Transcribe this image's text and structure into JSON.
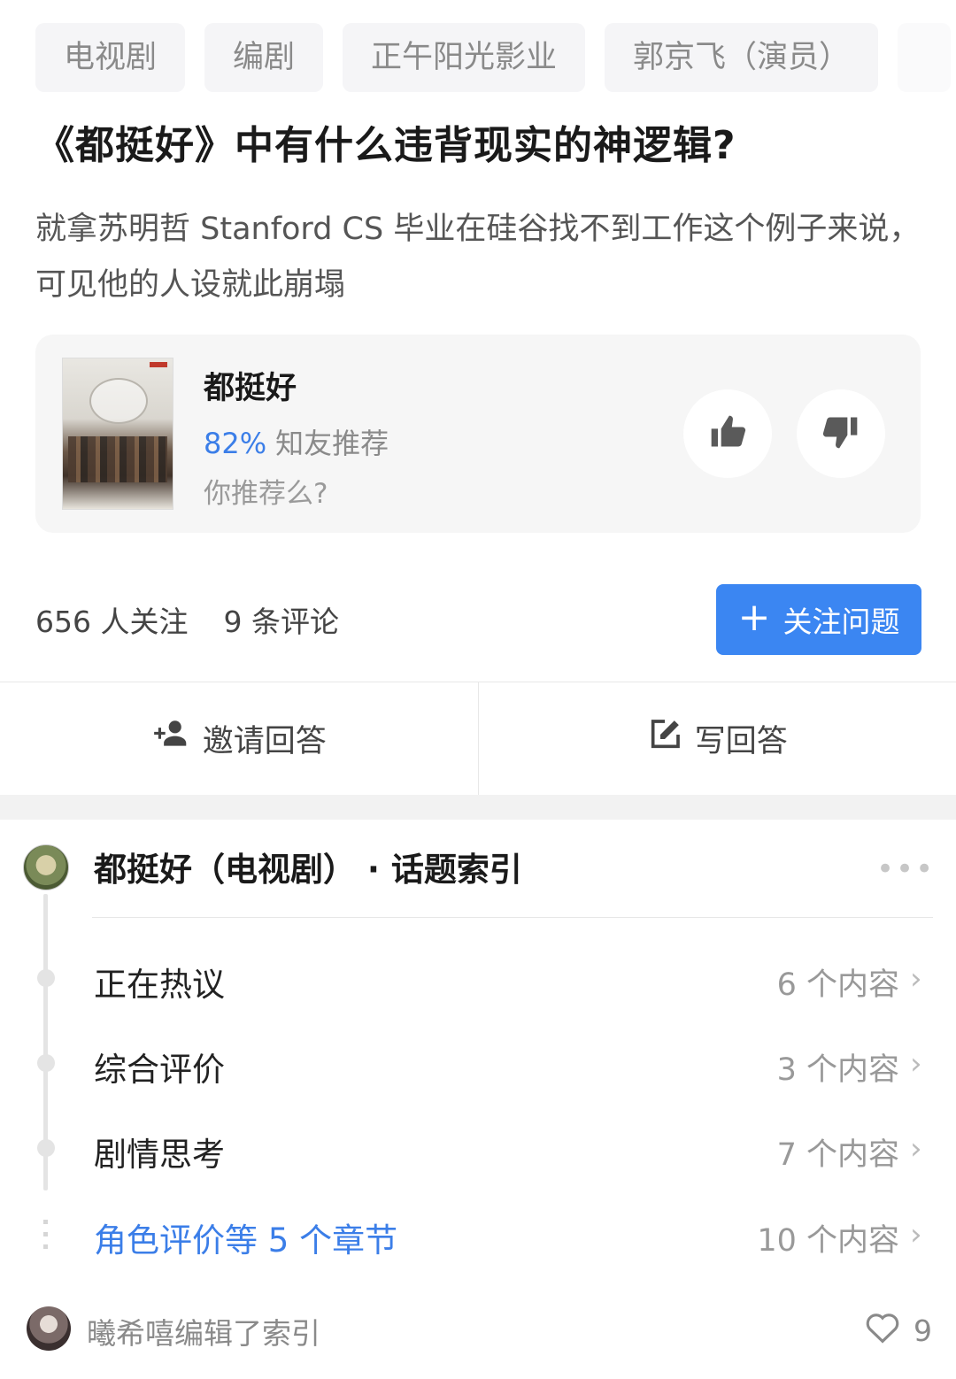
{
  "tags": [
    "电视剧",
    "编剧",
    "正午阳光影业",
    "郭京飞（演员）"
  ],
  "question": {
    "title": "《都挺好》中有什么违背现实的神逻辑?",
    "description": "就拿苏明哲 Stanford CS 毕业在硅谷找不到工作这个例子来说，可见他的人设就此崩塌"
  },
  "recommend_card": {
    "name": "都挺好",
    "percent": "82%",
    "percent_label": "知友推荐",
    "prompt": "你推荐么?",
    "upvote_icon": "thumbs-up-icon",
    "downvote_icon": "thumbs-down-icon"
  },
  "stats": {
    "followers": "656 人关注",
    "comments": "9 条评论"
  },
  "follow_button": {
    "label": "关注问题",
    "icon": "plus-icon",
    "color": "#3b86f2"
  },
  "actions": {
    "invite": {
      "label": "邀请回答",
      "icon": "add-person-icon"
    },
    "write": {
      "label": "写回答",
      "icon": "edit-icon"
    }
  },
  "topic_index": {
    "title": "都挺好（电视剧）",
    "suffix": "· 话题索引",
    "rows": [
      {
        "label": "正在热议",
        "count": "6 个内容"
      },
      {
        "label": "综合评价",
        "count": "3 个内容"
      },
      {
        "label": "剧情思考",
        "count": "7 个内容"
      }
    ],
    "more_row": {
      "label": "角色评价等 5 个章节",
      "count": "10 个内容"
    },
    "link_color": "#3b7ee8"
  },
  "editor": {
    "text": "曦希嘻编辑了索引",
    "likes": "9",
    "like_icon": "heart-icon"
  }
}
